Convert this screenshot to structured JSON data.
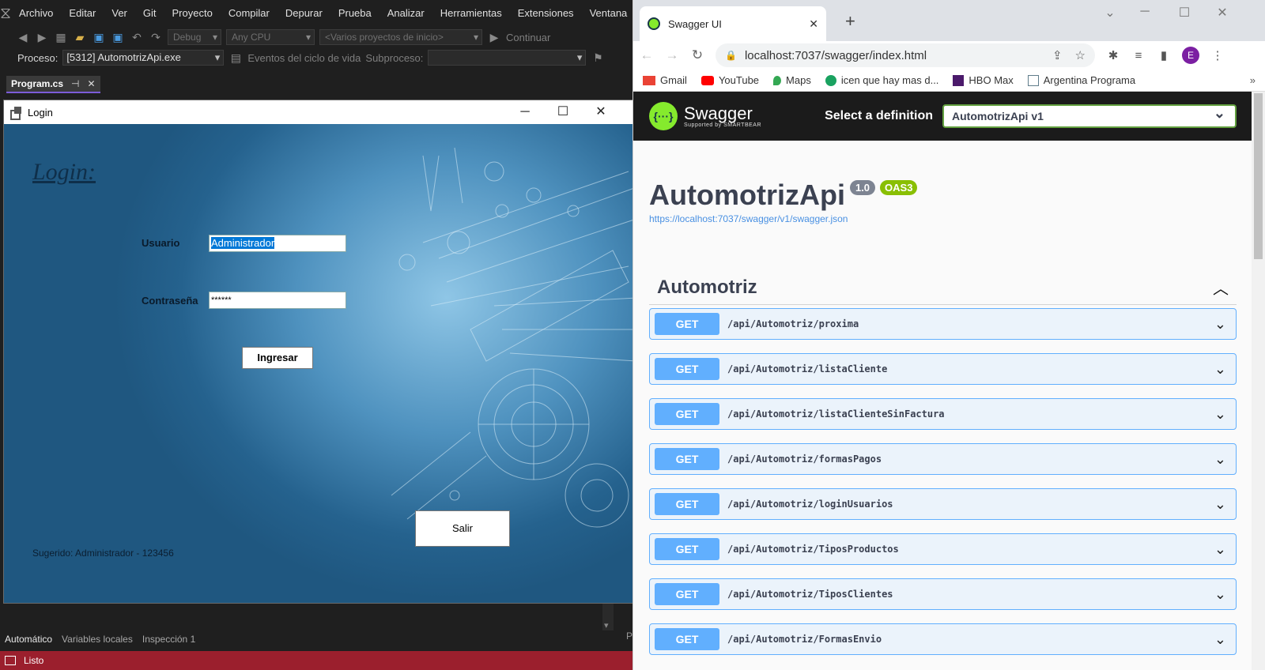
{
  "vs": {
    "menu": [
      "Archivo",
      "Editar",
      "Ver",
      "Git",
      "Proyecto",
      "Compilar",
      "Depurar",
      "Prueba",
      "Analizar",
      "Herramientas",
      "Extensiones",
      "Ventana"
    ],
    "toolbar": {
      "config": "Debug",
      "platform": "Any CPU",
      "startup": "<Varios proyectos de inicio>",
      "continue": "Continuar"
    },
    "process_bar": {
      "label": "Proceso:",
      "process": "[5312] AutomotrizApi.exe",
      "lifecycle": "Eventos del ciclo de vida",
      "thread_label": "Subproceso:"
    },
    "tab": {
      "name": "Program.cs"
    },
    "bottom_tabs": [
      "Automático",
      "Variables locales",
      "Inspección 1"
    ],
    "status": "Listo",
    "right_cut": "P"
  },
  "login": {
    "window_title": "Login",
    "heading": "Login:",
    "user_label": "Usuario",
    "user_value": "Administrador",
    "password_label": "Contraseña",
    "password_value": "******",
    "submit": "Ingresar",
    "exit": "Salir",
    "hint": "Sugerido:  Administrador - 123456"
  },
  "chrome": {
    "tab_title": "Swagger UI",
    "url": "localhost:7037/swagger/index.html",
    "avatar": "E",
    "bookmarks": [
      {
        "label": "Gmail",
        "color": "#ea4335"
      },
      {
        "label": "YouTube",
        "color": "#ff0000"
      },
      {
        "label": "Maps",
        "color": "#34a853"
      },
      {
        "label": "icen que hay mas d...",
        "color": "#1aa260"
      },
      {
        "label": "HBO Max",
        "color": "#4b1a6b"
      },
      {
        "label": "Argentina Programa",
        "color": "#607d8b"
      }
    ]
  },
  "swagger": {
    "brand": "Swagger",
    "brand_sub": "Supported by SMARTBEAR",
    "select_label": "Select a definition",
    "select_value": "AutomotrizApi v1",
    "title": "AutomotrizApi",
    "version": "1.0",
    "oas": "OAS3",
    "json_url": "https://localhost:7037/swagger/v1/swagger.json",
    "section": "Automotriz",
    "operations": [
      {
        "method": "GET",
        "path": "/api/Automotriz/proxima"
      },
      {
        "method": "GET",
        "path": "/api/Automotriz/listaCliente"
      },
      {
        "method": "GET",
        "path": "/api/Automotriz/listaClienteSinFactura"
      },
      {
        "method": "GET",
        "path": "/api/Automotriz/formasPagos"
      },
      {
        "method": "GET",
        "path": "/api/Automotriz/loginUsuarios"
      },
      {
        "method": "GET",
        "path": "/api/Automotriz/TiposProductos"
      },
      {
        "method": "GET",
        "path": "/api/Automotriz/TiposClientes"
      },
      {
        "method": "GET",
        "path": "/api/Automotriz/FormasEnvio"
      }
    ]
  },
  "colors": {
    "swagger_green": "#85ea2d",
    "get_blue": "#61affe",
    "vs_status_red": "#9b1f2d"
  }
}
